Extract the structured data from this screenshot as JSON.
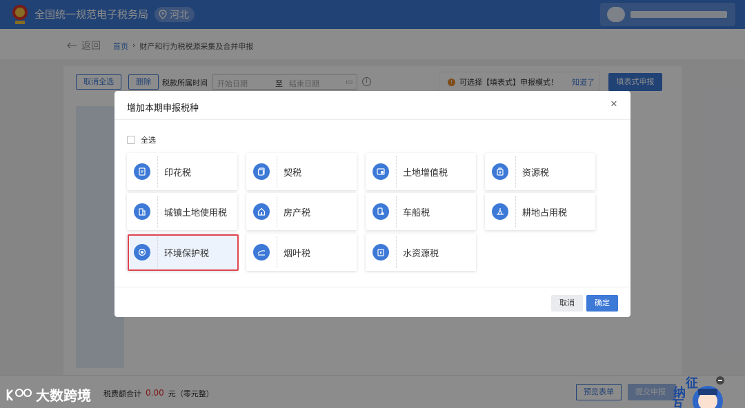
{
  "header": {
    "site_title": "全国统一规范电子税务局",
    "region": "河北"
  },
  "breadcrumb": {
    "back_label": "返回",
    "home": "首页",
    "current": "财产和行为税税源采集及合并申报"
  },
  "toolbar": {
    "cancel_all": "取消全选",
    "delete": "删除",
    "period_label": "税款所属时间",
    "start_placeholder": "开始日期",
    "to": "至",
    "end_placeholder": "结束日期",
    "notice_text": "可选择【填表式】申报模式！",
    "notice_ack": "知道了",
    "fill_mode_button": "填表式申报"
  },
  "footer": {
    "total_label": "税费额合计",
    "total_amount": "0.00",
    "unit": "元（零元整）",
    "preview_button": "预览表单",
    "submit_button": "提交申报",
    "brand": "大数跨境",
    "mascot_chars": [
      "纳",
      "征",
      "互"
    ]
  },
  "modal": {
    "title": "增加本期申报税种",
    "select_all": "全选",
    "cancel": "取消",
    "confirm": "确定",
    "taxes": [
      {
        "label": "印花税",
        "icon": "stamp-doc-icon"
      },
      {
        "label": "契税",
        "icon": "deed-doc-icon"
      },
      {
        "label": "土地增值税",
        "icon": "land-value-icon"
      },
      {
        "label": "资源税",
        "icon": "resource-icon"
      },
      {
        "label": "城镇土地使用税",
        "icon": "urban-land-icon"
      },
      {
        "label": "房产税",
        "icon": "house-icon"
      },
      {
        "label": "车船税",
        "icon": "vehicle-icon"
      },
      {
        "label": "耕地占用税",
        "icon": "farmland-icon"
      },
      {
        "label": "环境保护税",
        "icon": "environment-icon",
        "selected": true
      },
      {
        "label": "烟叶税",
        "icon": "tobacco-icon"
      },
      {
        "label": "水资源税",
        "icon": "water-icon"
      }
    ]
  },
  "colors": {
    "primary": "#3d79d6",
    "highlight": "#e0454d",
    "amount": "#e02b2b"
  }
}
